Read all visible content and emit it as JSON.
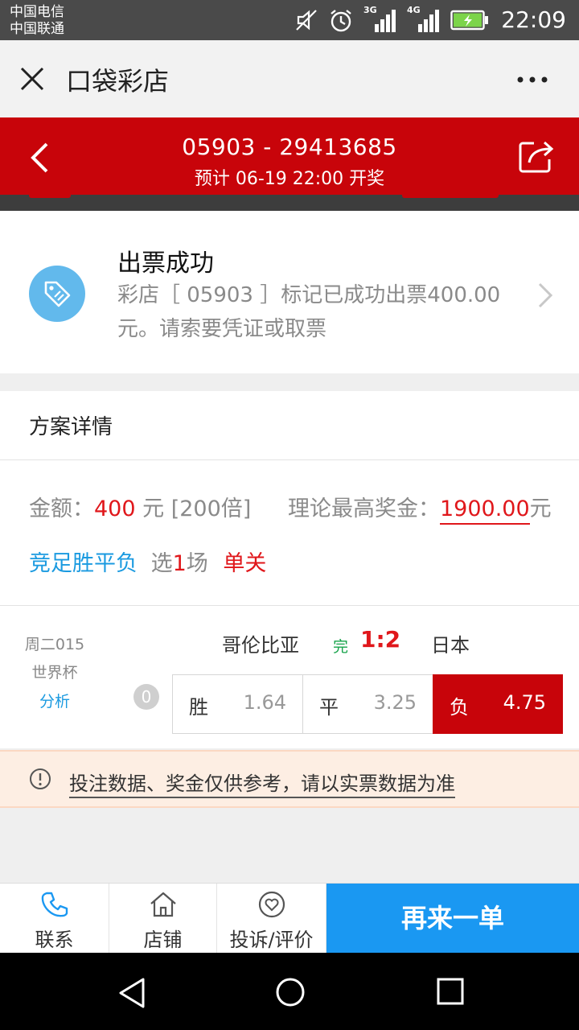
{
  "status_bar": {
    "carrier_1": "中国电信",
    "carrier_2": "中国联通",
    "signal_1_label": "3G",
    "signal_2_label": "4G",
    "time": "22:09"
  },
  "app_bar": {
    "title": "口袋彩店"
  },
  "header": {
    "order_id": "05903 - 29413685",
    "draw_time": "预计 06-19 22:00 开奖"
  },
  "ticket_status": {
    "title": "出票成功",
    "description": "彩店［ 05903 ］标记已成功出票400.00元。请索要凭证或取票"
  },
  "plan": {
    "section_title": "方案详情",
    "amount_label": "金额：",
    "amount_value": "400",
    "amount_unit": " 元 [200倍]",
    "max_prize_label": "理论最高奖金：",
    "max_prize_value": "1900.00",
    "max_prize_unit": "元",
    "game_type": "竞足胜平负",
    "select_prefix": "选",
    "select_count": "1",
    "select_suffix": "场",
    "pass_type": "单关",
    "match": {
      "code": "周二015",
      "league": "世界杯",
      "analysis_link": "分析",
      "handicap": "0",
      "home_team": "哥伦比亚",
      "status": "完",
      "score": "1:2",
      "away_team": "日本",
      "odds": [
        {
          "label": "胜",
          "value": "1.64",
          "selected": false
        },
        {
          "label": "平",
          "value": "3.25",
          "selected": false
        },
        {
          "label": "负",
          "value": "4.75",
          "selected": true
        }
      ]
    }
  },
  "notice": {
    "text": "投注数据、奖金仅供参考，请以实票数据为准"
  },
  "tab_bar": {
    "contact": "联系",
    "shop": "店铺",
    "complaint": "投诉/评价",
    "reorder": "再来一单"
  },
  "colors": {
    "brand_red": "#c8040a",
    "accent_blue": "#1a98f2",
    "icon_circle": "#62b9ec"
  }
}
